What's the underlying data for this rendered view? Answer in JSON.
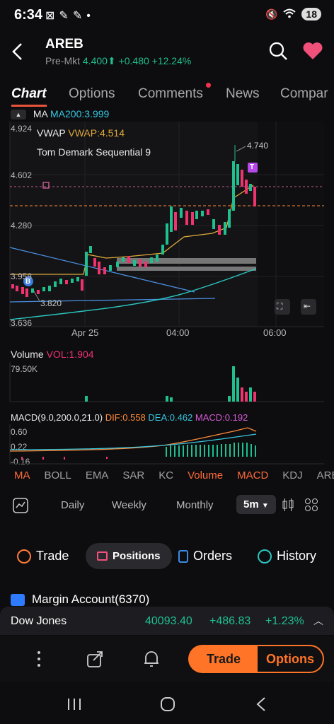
{
  "status_bar": {
    "time": "6:34",
    "battery": "18"
  },
  "header": {
    "ticker": "AREB",
    "premkt_label": "Pre-Mkt",
    "price": "4.400",
    "change": "+0.480",
    "change_pct": "+12.24%"
  },
  "tabs": [
    "Chart",
    "Options",
    "Comments",
    "News",
    "Compar"
  ],
  "chart": {
    "ma_label": "MA",
    "ma200": "MA200:3.999",
    "vwap_label": "VWAP",
    "vwap_value": "VWAP:4.514",
    "tds_label": "Tom Demark Sequential 9",
    "y_ticks": [
      "4.924",
      "4.602",
      "4.280",
      "3.958",
      "3.636"
    ],
    "high_label": "4.740",
    "low_label": "3.820",
    "x_ticks": [
      "Apr 25",
      "04:00",
      "06:00"
    ],
    "buy_marker": "B",
    "t_marker": "T"
  },
  "volume": {
    "label": "Volume",
    "vol": "VOL:1.904",
    "y_top": "79.50K"
  },
  "macd": {
    "label": "MACD(9.0,200.0,21.0)",
    "dif": "DIF:0.558",
    "dea": "DEA:0.462",
    "macd": "MACD:0.192",
    "ticks": [
      "0.60",
      "0.22",
      "-0.16"
    ]
  },
  "indicators": [
    "MA",
    "BOLL",
    "EMA",
    "SAR",
    "KC",
    "Volume",
    "MACD",
    "KDJ",
    "ARBR"
  ],
  "periods": [
    "Daily",
    "Weekly",
    "Monthly",
    "5m"
  ],
  "actions": {
    "trade": "Trade",
    "positions": "Positions",
    "orders": "Orders",
    "history": "History"
  },
  "margin": {
    "label": "Margin Account(6370)"
  },
  "dow": {
    "name": "Dow Jones",
    "value": "40093.40",
    "change": "+486.83",
    "pct": "+1.23%"
  },
  "toolbar": {
    "trade": "Trade",
    "options": "Options"
  },
  "colors": {
    "up": "#1fbf8f",
    "down": "#f0326e",
    "accent": "#ff7426"
  }
}
